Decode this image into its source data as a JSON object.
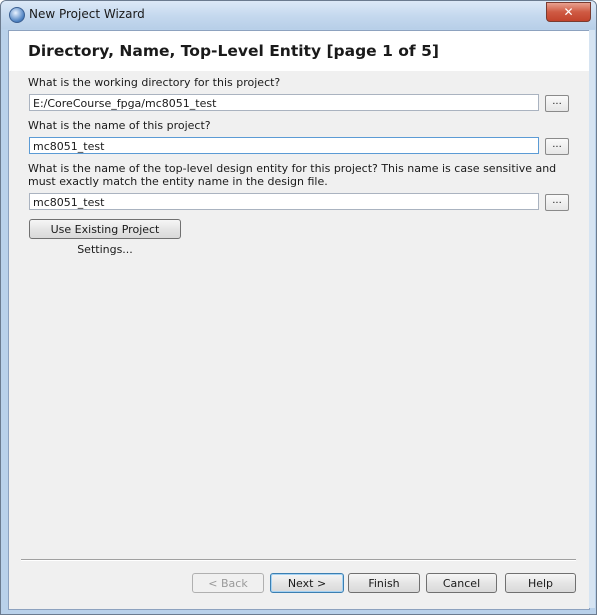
{
  "window": {
    "title": "New Project Wizard",
    "close_label": "✕"
  },
  "page": {
    "title": "Directory, Name, Top-Level Entity [page 1 of 5]"
  },
  "fields": {
    "working_dir": {
      "question": "What is the working directory for this project?",
      "value": "E:/CoreCourse_fpga/mc8051_test",
      "browse_label": "..."
    },
    "project_name": {
      "question": "What is the name of this project?",
      "value": "mc8051_test",
      "browse_label": "..."
    },
    "top_entity": {
      "question": "What is the name of the top-level design entity for this project? This name is case sensitive and must exactly match the entity name in the design file.",
      "value": "mc8051_test",
      "browse_label": "..."
    }
  },
  "use_existing_label": "Use Existing Project Settings...",
  "buttons": {
    "back": "< Back",
    "next": "Next >",
    "finish": "Finish",
    "cancel": "Cancel",
    "help": "Help"
  }
}
